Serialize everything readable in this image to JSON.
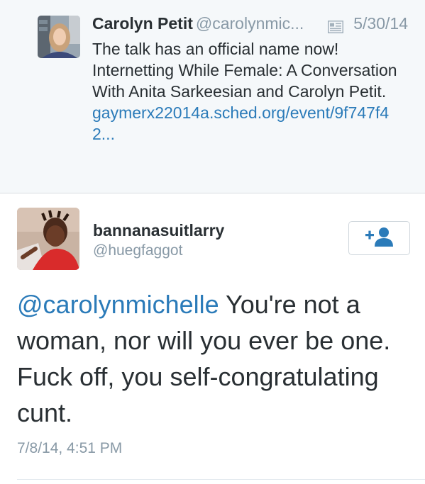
{
  "parent_tweet": {
    "author_name": "Carolyn Petit",
    "author_handle": "@carolynmic...",
    "date": "5/30/14",
    "text": "The talk has an official name now! Internetting While Female: A Conversation With Anita Sarkeesian and Carolyn Petit.",
    "link_text": "gaymerx22014a.sched.org/event/9f747f42..."
  },
  "reply_tweet": {
    "author_name": "bannanasuitlarry",
    "author_handle": "@huegfaggot",
    "mention": "@carolynmichelle",
    "text": " You're not a woman, nor will you ever be one. Fuck off, you self-congratulating cunt.",
    "timestamp": "7/8/14, 4:51 PM",
    "follow_button_icon": "follow-user-icon"
  },
  "colors": {
    "link": "#2b7bb9",
    "muted": "#8899a6",
    "text": "#292f33",
    "parent_background": "#f5f8fa"
  }
}
